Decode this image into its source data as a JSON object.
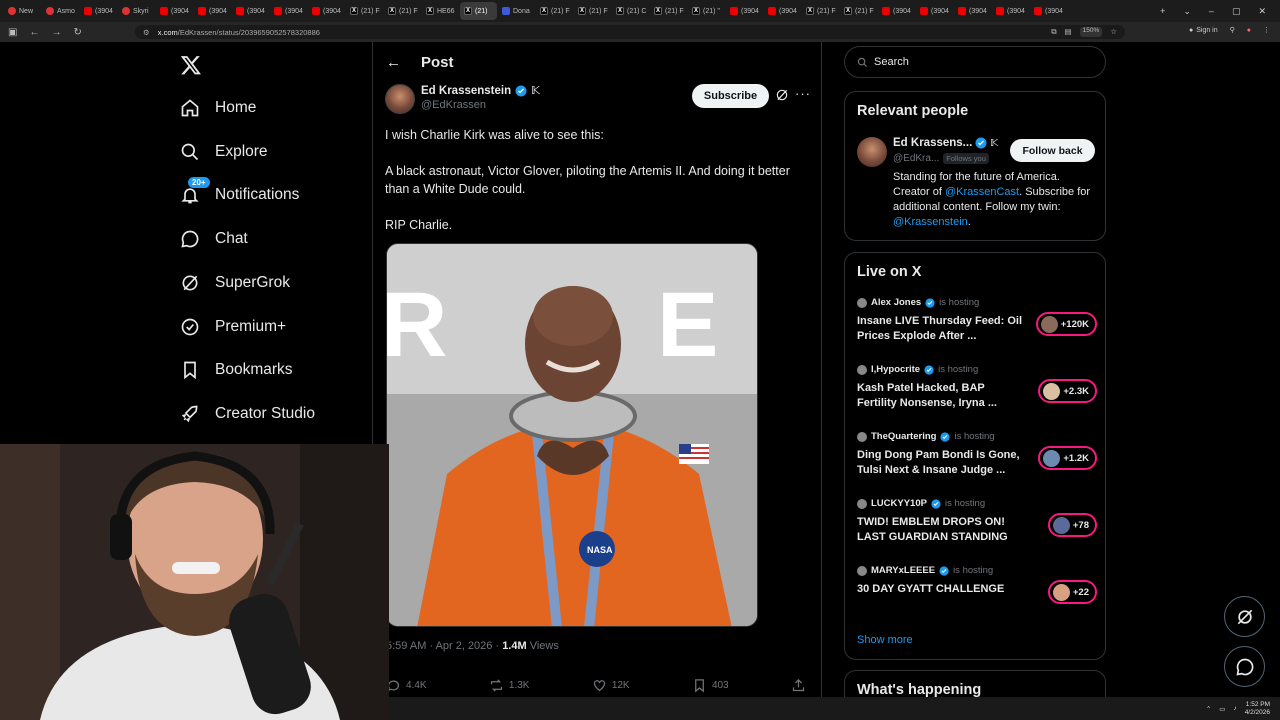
{
  "browser": {
    "tabs": [
      {
        "label": "New",
        "icon": "ot"
      },
      {
        "label": "Asmo",
        "icon": "ot"
      },
      {
        "label": "(3904",
        "icon": "yt"
      },
      {
        "label": "Skyri",
        "icon": "ot"
      },
      {
        "label": "(3904",
        "icon": "yt"
      },
      {
        "label": "(3904",
        "icon": "yt"
      },
      {
        "label": "(3904",
        "icon": "yt"
      },
      {
        "label": "(3904",
        "icon": "yt"
      },
      {
        "label": "(3904",
        "icon": "yt"
      },
      {
        "label": "(21) F",
        "icon": "x"
      },
      {
        "label": "(21) F",
        "icon": "x"
      },
      {
        "label": "HE66",
        "icon": "x"
      },
      {
        "label": "(21)",
        "icon": "x",
        "active": true
      },
      {
        "label": "Dona",
        "icon": "tr"
      },
      {
        "label": "(21) F",
        "icon": "x"
      },
      {
        "label": "(21) F",
        "icon": "x"
      },
      {
        "label": "(21) C",
        "icon": "x"
      },
      {
        "label": "(21) F",
        "icon": "x"
      },
      {
        "label": "(21) \"",
        "icon": "x"
      },
      {
        "label": "(3904",
        "icon": "yt"
      },
      {
        "label": "(3904",
        "icon": "yt"
      },
      {
        "label": "(21) F",
        "icon": "x"
      },
      {
        "label": "(21) F",
        "icon": "x"
      },
      {
        "label": "(3904",
        "icon": "yt"
      },
      {
        "label": "(3904",
        "icon": "yt"
      },
      {
        "label": "(3904",
        "icon": "yt"
      },
      {
        "label": "(3904",
        "icon": "yt"
      },
      {
        "label": "(3904",
        "icon": "yt"
      }
    ],
    "url_domain": "x.com",
    "url_path": "/EdKrassen/status/2039659052578320886",
    "zoom": "150%",
    "signin": "Sign in"
  },
  "nav": {
    "items": [
      {
        "label": "Home",
        "icon": "home-icon"
      },
      {
        "label": "Explore",
        "icon": "search-icon"
      },
      {
        "label": "Notifications",
        "icon": "bell-icon",
        "badge": "20+"
      },
      {
        "label": "Chat",
        "icon": "chat-icon"
      },
      {
        "label": "SuperGrok",
        "icon": "grok-icon"
      },
      {
        "label": "Premium+",
        "icon": "premium-icon"
      },
      {
        "label": "Bookmarks",
        "icon": "bookmark-icon"
      },
      {
        "label": "Creator Studio",
        "icon": "rocket-icon"
      }
    ]
  },
  "post": {
    "header_title": "Post",
    "author_name": "Ed Krassenstein",
    "author_handle": "@EdKrassen",
    "subscribe_label": "Subscribe",
    "text": [
      "I wish Charlie Kirk was alive to see this:",
      "A black astronaut, Victor Glover, piloting the Artemis II. And doing it better than a White Dude could.",
      "RIP Charlie."
    ],
    "time": "5:59 AM · Apr 2, 2026 · ",
    "views_count": "1.4M",
    "views_label": " Views",
    "replies": "4.4K",
    "reposts": "1.3K",
    "likes": "12K",
    "bookmarks": "403"
  },
  "sidebar": {
    "search_placeholder": "Search",
    "relevant_title": "Relevant people",
    "relevant": {
      "name": "Ed Krassens...",
      "handle": "@EdKra...",
      "follows_you": "Follows you",
      "button": "Follow back",
      "bio_1": "Standing for the future of America. Creator of ",
      "bio_link1": "@KrassenCast",
      "bio_2": ". Subscribe for additional content. Follow my twin: ",
      "bio_link2": "@Krassenstein",
      "bio_3": "."
    },
    "live_title": "Live on X",
    "hosting_label": "is hosting",
    "live": [
      {
        "host": "Alex Jones",
        "title": "Insane LIVE Thursday Feed: Oil Prices Explode After ...",
        "count": "+120K"
      },
      {
        "host": "I,Hypocrite",
        "title": "Kash Patel Hacked, BAP Fertility Nonsense, Iryna ...",
        "count": "+2.3K"
      },
      {
        "host": "TheQuartering",
        "title": "Ding Dong Pam Bondi Is Gone, Tulsi Next & Insane Judge ...",
        "count": "+1.2K"
      },
      {
        "host": "LUCKYY10P",
        "title": "TWID! EMBLEM DROPS ON! LAST GUARDIAN STANDING",
        "count": "+78"
      },
      {
        "host": "MARYxLEEEE",
        "title": "30 DAY GYATT CHALLENGE",
        "count": "+22"
      }
    ],
    "show_more": "Show more",
    "whats_happening": "What's happening"
  },
  "taskbar": {
    "time": "1:52 PM",
    "date": "4/2/2026"
  },
  "colors": {
    "accent": "#1d9bf0",
    "live": "#f91880",
    "background": "#000000",
    "border": "#2f3336"
  }
}
